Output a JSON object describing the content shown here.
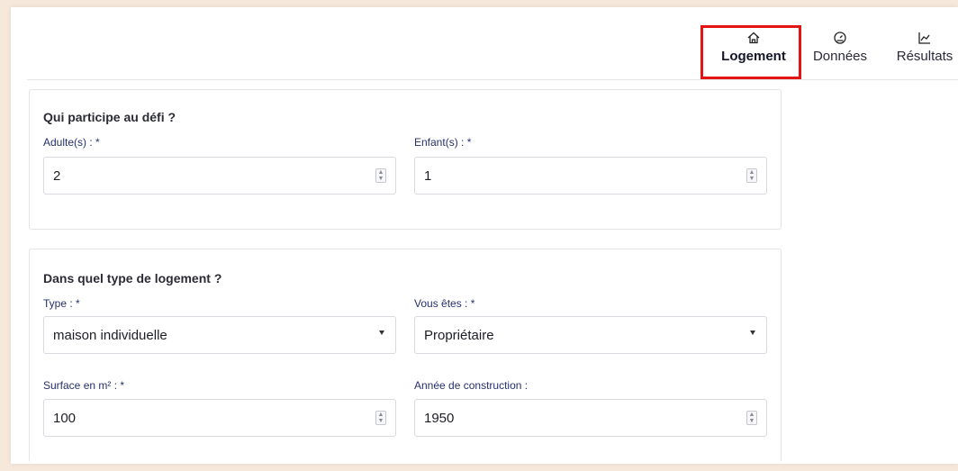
{
  "tabs": [
    {
      "label": "Logement",
      "icon": "home-icon",
      "active": true
    },
    {
      "label": "Données",
      "icon": "gauge-icon",
      "active": false
    },
    {
      "label": "Résultats",
      "icon": "chart-icon",
      "active": false
    }
  ],
  "participants": {
    "title": "Qui participe au défi ?",
    "adults_label": "Adulte(s) : *",
    "adults_value": "2",
    "children_label": "Enfant(s) : *",
    "children_value": "1"
  },
  "housing": {
    "title": "Dans quel type de logement ?",
    "type_label": "Type : *",
    "type_value": "maison individuelle",
    "status_label": "Vous êtes : *",
    "status_value": "Propriétaire",
    "surface_label": "Surface en m² : *",
    "surface_value": "100",
    "year_label": "Année de construction :",
    "year_value": "1950"
  },
  "colors": {
    "highlight": "#e21414",
    "label": "#25306e",
    "background": "#f7e8dc"
  }
}
